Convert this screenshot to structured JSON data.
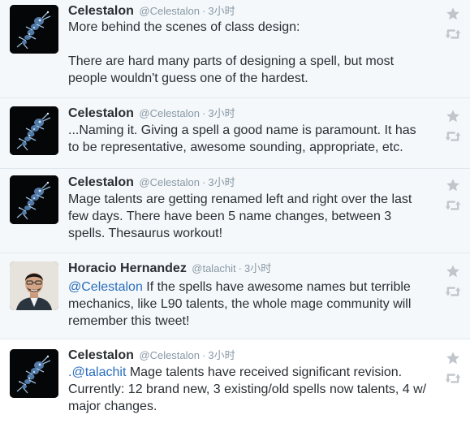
{
  "tweets": [
    {
      "fullname": "Celestalon",
      "username": "@Celestalon",
      "separator": "·",
      "time": "3小时",
      "text_lines": [
        "More behind the scenes of class design:",
        "",
        "There are hard many parts of designing a spell, but most people wouldn't guess one of the hardest."
      ]
    },
    {
      "fullname": "Celestalon",
      "username": "@Celestalon",
      "separator": "·",
      "time": "3小时",
      "text": "...Naming it. Giving a spell a good name is paramount. It has to be representative, awesome sounding, appropriate, etc."
    },
    {
      "fullname": "Celestalon",
      "username": "@Celestalon",
      "separator": "·",
      "time": "3小时",
      "text": "Mage talents are getting renamed left and right over the last few days. There have been 5 name changes, between 3 spells. Thesaurus workout!"
    },
    {
      "fullname": "Horacio Hernandez",
      "username": "@talachit",
      "separator": "·",
      "time": "3小时",
      "mention": "@Celestalon",
      "text": " If the spells have awesome names but terrible mechanics, like L90 talents, the whole mage community will remember this tweet!"
    },
    {
      "fullname": "Celestalon",
      "username": "@Celestalon",
      "separator": "·",
      "time": "3小时",
      "prefix": ".",
      "mention": "@talachit",
      "text": " Mage talents have received significant revision. Currently: 12 brand new, 3 existing/old spells now talents, 4 w/ major changes."
    }
  ],
  "icons": {
    "favorite": "star-icon",
    "retweet": "retweet-icon",
    "avatar_celestalon": "celestalon-avatar",
    "avatar_horacio": "horacio-avatar"
  },
  "colors": {
    "link": "#2a6ebb",
    "name": "#292f33",
    "secondary": "#8899a6",
    "action_icon": "#c0c6cb",
    "background": "#f5f8fa",
    "expanded_background": "#ffffff"
  }
}
